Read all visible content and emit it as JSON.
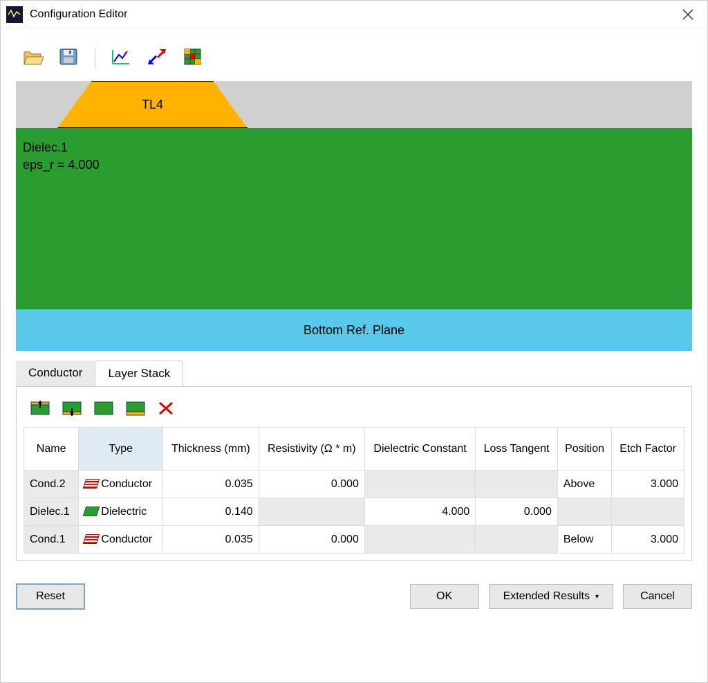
{
  "window": {
    "title": "Configuration Editor"
  },
  "diagram": {
    "tl_label": "TL4",
    "dielec_name": "Dielec.1",
    "dielec_eps": "eps_r = 4.000",
    "bottom_plane": "Bottom Ref. Plane"
  },
  "tabs": {
    "conductor": "Conductor",
    "layer_stack": "Layer Stack",
    "active": "layer_stack"
  },
  "table": {
    "headers": {
      "name": "Name",
      "type": "Type",
      "thickness": "Thickness (mm)",
      "resistivity": "Resistivity (Ω * m)",
      "dielec_const": "Dielectric Constant",
      "loss_tangent": "Loss Tangent",
      "position": "Position",
      "etch_factor": "Etch Factor"
    },
    "rows": [
      {
        "name": "Cond.2",
        "type": "Conductor",
        "type_kind": "cond",
        "thickness": "0.035",
        "resistivity": "0.000",
        "dielec_const": "",
        "loss_tangent": "",
        "position": "Above",
        "etch_factor": "3.000"
      },
      {
        "name": "Dielec.1",
        "type": "Dielectric",
        "type_kind": "diel",
        "thickness": "0.140",
        "resistivity": "",
        "dielec_const": "4.000",
        "loss_tangent": "0.000",
        "position": "",
        "etch_factor": ""
      },
      {
        "name": "Cond.1",
        "type": "Conductor",
        "type_kind": "cond",
        "thickness": "0.035",
        "resistivity": "0.000",
        "dielec_const": "",
        "loss_tangent": "",
        "position": "Below",
        "etch_factor": "3.000"
      }
    ]
  },
  "buttons": {
    "reset": "Reset",
    "ok": "OK",
    "extended": "Extended Results",
    "cancel": "Cancel"
  },
  "toolbar_top": {
    "icons": [
      "open-icon",
      "save-icon",
      "chart-icon",
      "expand-icon",
      "grid-icon"
    ]
  },
  "toolbar_layers": {
    "icons": [
      "add-above-icon",
      "add-below-icon",
      "add-dielec-icon",
      "add-ground-icon",
      "delete-icon"
    ]
  }
}
